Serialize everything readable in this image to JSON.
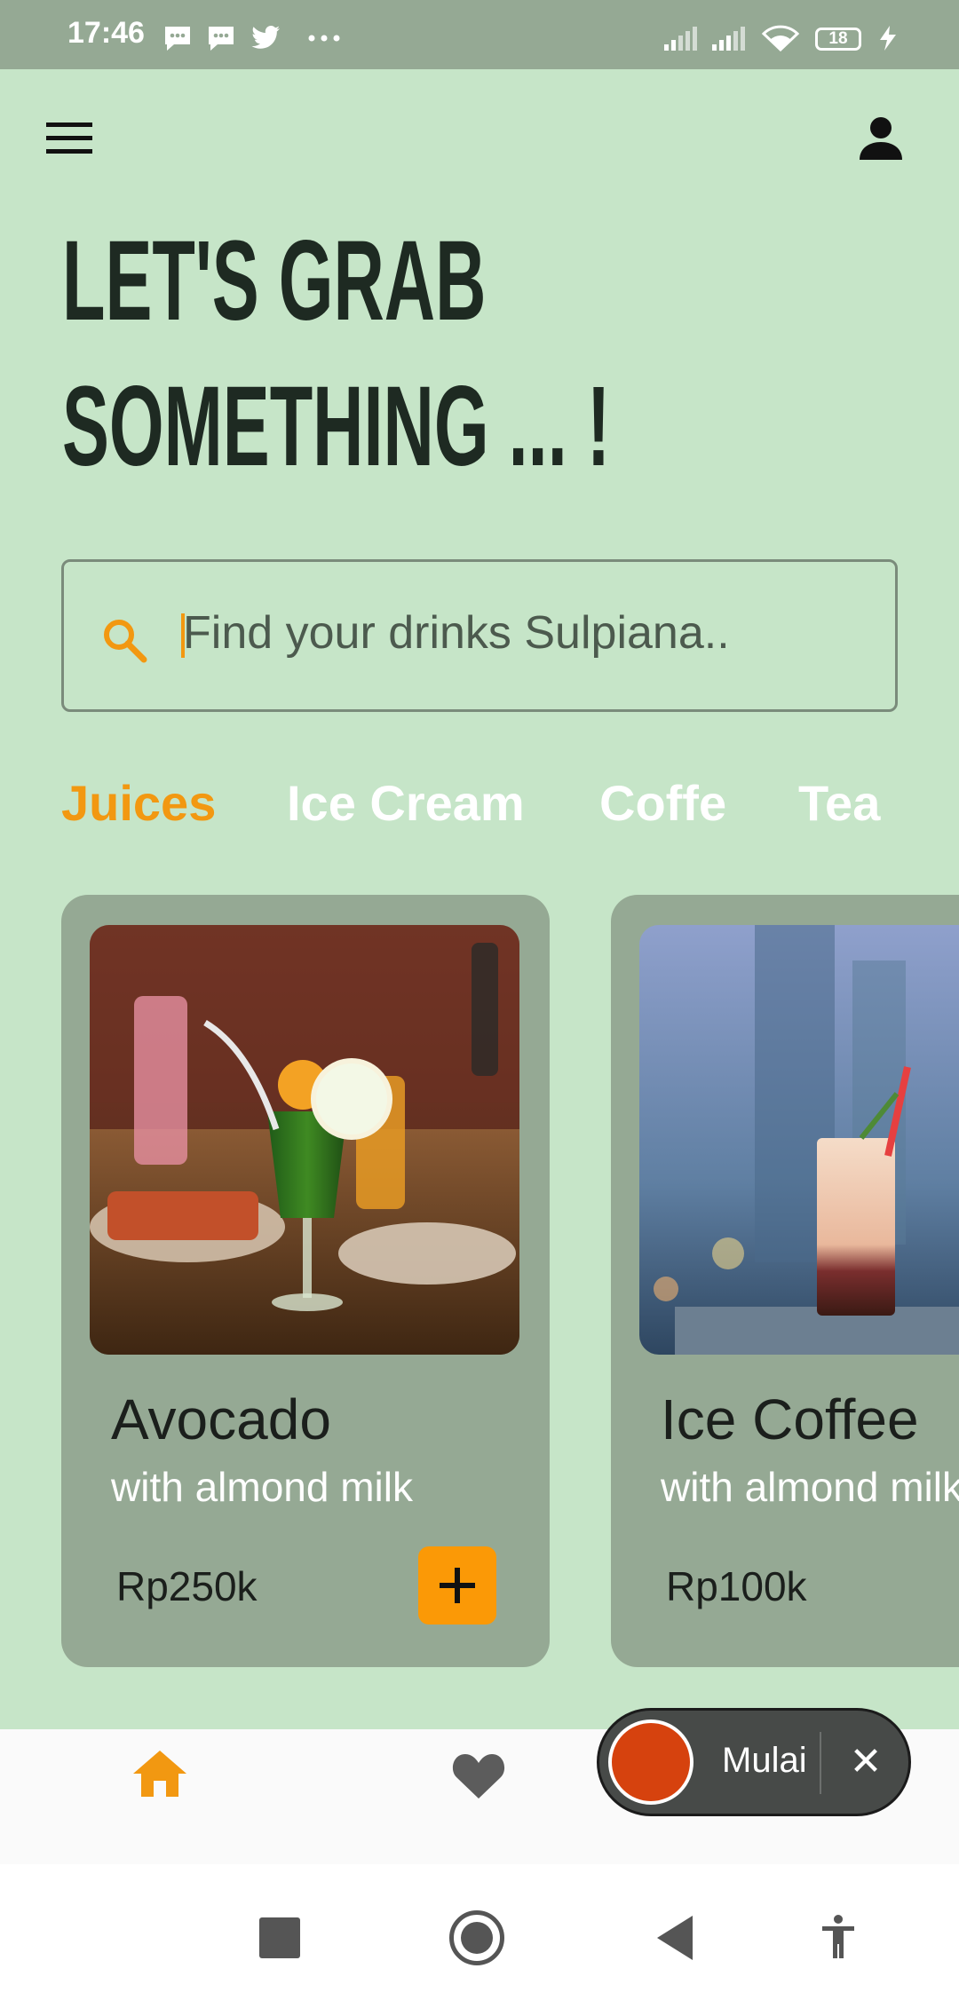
{
  "status_bar": {
    "time": "17:46",
    "battery": "18",
    "icons": [
      "message-icon",
      "message-icon",
      "twitter-icon",
      "more-dots-icon",
      "signal-icon",
      "signal-icon",
      "wifi-icon",
      "battery-icon",
      "charging-icon"
    ]
  },
  "header": {
    "menu_icon": "hamburger-menu-icon",
    "profile_icon": "person-icon",
    "title_line1": "LET'S GRAB",
    "title_line2": "SOMETHING ... !"
  },
  "search": {
    "placeholder": "Find your drinks Sulpiana..",
    "icon": "search-icon"
  },
  "categories": [
    {
      "label": "Juices",
      "active": true
    },
    {
      "label": "Ice Cream",
      "active": false
    },
    {
      "label": "Coffe",
      "active": false
    },
    {
      "label": "Tea",
      "active": false
    }
  ],
  "products": [
    {
      "name": "Avocado",
      "subtitle": "with almond milk",
      "price": "Rp250k",
      "add_label": "+"
    },
    {
      "name": "Ice Coffee",
      "subtitle": "with almond milk",
      "price": "Rp100k"
    }
  ],
  "bottom_nav": {
    "items": [
      "home-icon",
      "heart-icon",
      "bell-icon"
    ],
    "active_color": "#f29811",
    "inactive_color": "#5c5c5c"
  },
  "recorder": {
    "label": "Mulai",
    "close": "✕"
  },
  "system_nav": [
    "square-icon",
    "circle-icon",
    "back-triangle-icon",
    "accessibility-icon"
  ],
  "colors": {
    "background": "#c6e5c8",
    "card": "#95a994",
    "accent": "#f29811",
    "status_bar": "#95a994"
  }
}
